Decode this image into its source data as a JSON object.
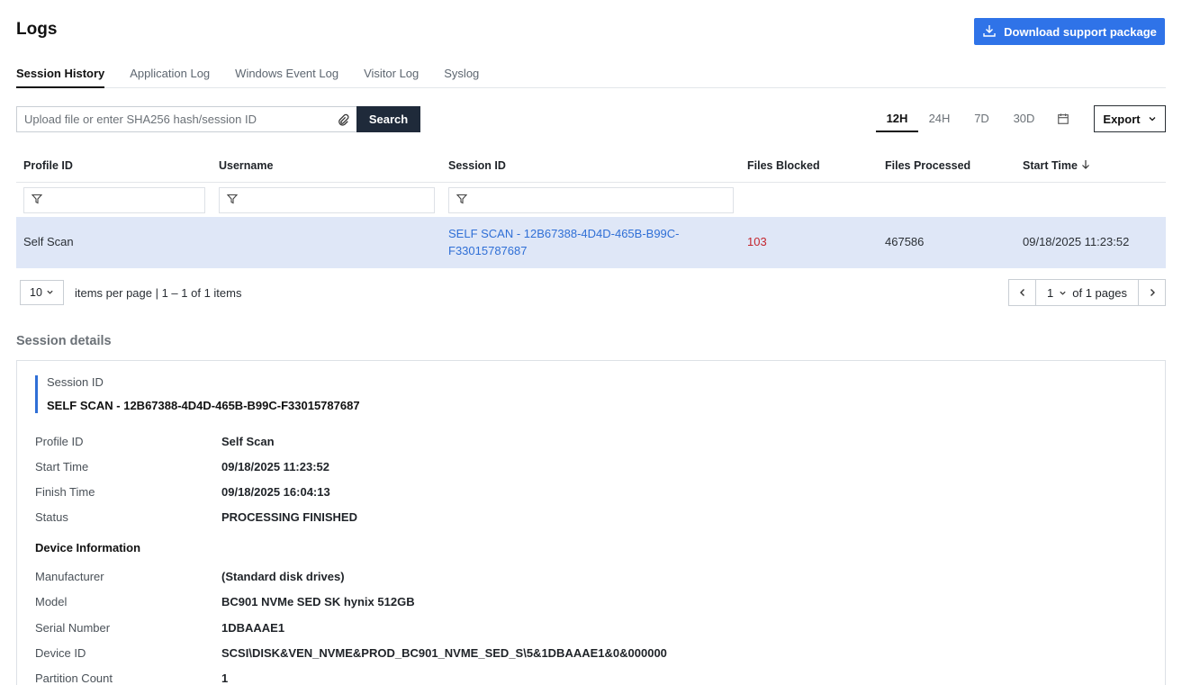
{
  "header": {
    "title": "Logs",
    "download_label": "Download support package"
  },
  "tabs": [
    "Session History",
    "Application Log",
    "Windows Event Log",
    "Visitor Log",
    "Syslog"
  ],
  "search": {
    "placeholder": "Upload file or enter SHA256 hash/session ID",
    "button": "Search"
  },
  "time_ranges": [
    "12H",
    "24H",
    "7D",
    "30D"
  ],
  "active_range": "12H",
  "export_label": "Export",
  "table": {
    "columns": [
      "Profile ID",
      "Username",
      "Session ID",
      "Files Blocked",
      "Files Processed",
      "Start Time"
    ],
    "rows": [
      {
        "profile_id": "Self Scan",
        "username": "",
        "session_id_line1": "SELF SCAN - 12B67388-4D4D-465B-B99C-",
        "session_id_line2": "F33015787687",
        "files_blocked": "103",
        "files_processed": "467586",
        "start_time": "09/18/2025 11:23:52"
      }
    ]
  },
  "pager": {
    "page_size": "10",
    "items_text": "items per page | 1 – 1 of 1 items",
    "page": "1",
    "pages_text": "of 1 pages"
  },
  "details": {
    "section_title": "Session details",
    "session_id_label": "Session ID",
    "session_id_value": "SELF SCAN - 12B67388-4D4D-465B-B99C-F33015787687",
    "fields": [
      {
        "key": "Profile ID",
        "value": "Self Scan"
      },
      {
        "key": "Start Time",
        "value": "09/18/2025 11:23:52"
      },
      {
        "key": "Finish Time",
        "value": "09/18/2025 16:04:13"
      },
      {
        "key": "Status",
        "value": "PROCESSING FINISHED"
      }
    ],
    "device_heading": "Device Information",
    "device_fields": [
      {
        "key": "Manufacturer",
        "value": "(Standard disk drives)"
      },
      {
        "key": "Model",
        "value": "BC901 NVMe SED SK hynix 512GB"
      },
      {
        "key": "Serial Number",
        "value": "1DBAAAE1"
      },
      {
        "key": "Device ID",
        "value": "SCSI\\DISK&VEN_NVME&PROD_BC901_NVME_SED_S\\5&1DBAAAE1&0&000000"
      },
      {
        "key": "Partition Count",
        "value": "1"
      }
    ]
  },
  "colors": {
    "accent": "#2f73e8",
    "link": "#2f6fd6",
    "blocked": "#c4262e",
    "selected_row": "#dfe7f7",
    "search_button": "#1f2a3a"
  }
}
